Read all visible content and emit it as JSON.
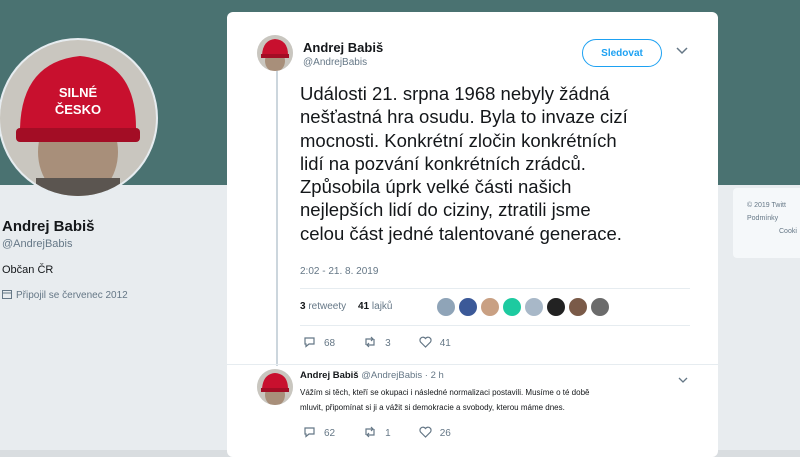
{
  "profile": {
    "cap_line1": "SILNÉ",
    "cap_line2": "ČESKO",
    "name": "Andrej Babiš",
    "handle": "@AndrejBabis",
    "bio": "Občan ČR",
    "joined": "Připojil se červenec 2012"
  },
  "footer": {
    "line1": "© 2019 Twitt",
    "line2": "Podmínky",
    "line3": "Cooki"
  },
  "tweet": {
    "author_name": "Andrej Babiš",
    "author_handle": "@AndrejBabis",
    "follow_label": "Sledovat",
    "text_lines": [
      "Události 21. srpna 1968 nebyly žádná",
      "nešťastná hra osudu. Byla to invaze cizí",
      "mocnosti. Konkrétní zločin konkrétních",
      "lidí na pozvání konkrétních zrádců.",
      "Způsobila úprk velké části našich",
      "nejlepších lidí do ciziny, ztratili jsme",
      "celou část jedné talentované generace."
    ],
    "time": "2:02 - 21. 8. 2019",
    "retweets_count": "3",
    "retweets_label": "retweety",
    "likes_count": "41",
    "likes_label": "lajků",
    "replies": "68",
    "retweets": "3",
    "likes": "41"
  },
  "reply": {
    "author_name": "Andrej Babiš",
    "author_handle": "@AndrejBabis",
    "age": "· 2 h",
    "text_lines": [
      "Vážím si těch, kteří se okupaci i následné normalizaci postavili. Musíme o té době",
      "mluvit, připomínat si ji a vážit si demokracie a svobody, kterou máme dnes."
    ],
    "replies": "62",
    "retweets": "1",
    "likes": "26"
  },
  "colors": {
    "banner": "#4a7271",
    "accent": "#1da1f2",
    "cap_red": "#c8102e"
  },
  "icons": {
    "reply": "reply-icon",
    "retweet": "retweet-icon",
    "like": "heart-icon",
    "calendar": "calendar-icon",
    "menu": "chevron-down-icon"
  }
}
